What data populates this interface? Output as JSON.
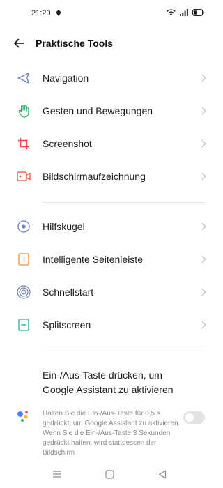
{
  "status_bar": {
    "time": "21:20",
    "icons": [
      "location-icon",
      "wifi-icon",
      "signal-icon",
      "battery-icon"
    ]
  },
  "header": {
    "back_icon": "arrow-left-icon",
    "title": "Praktische Tools"
  },
  "groups": [
    {
      "items": [
        {
          "label": "Navigation",
          "icon": "navigation-arrow-icon",
          "icon_color": "#6b7db3"
        },
        {
          "label": "Gesten und Bewegungen",
          "icon": "hand-gesture-icon",
          "icon_color": "#3aa76d"
        },
        {
          "label": "Screenshot",
          "icon": "crop-icon",
          "icon_color": "#e0533a"
        },
        {
          "label": "Bildschirmaufzeichnung",
          "icon": "screen-record-icon",
          "icon_color": "#e0533a"
        }
      ]
    },
    {
      "items": [
        {
          "label": "Hilfskugel",
          "icon": "assistive-ball-icon",
          "icon_color": "#6b7db3"
        },
        {
          "label": "Intelligente Seitenleiste",
          "icon": "sidebar-icon",
          "icon_color": "#e8923a"
        },
        {
          "label": "Schnellstart",
          "icon": "fingerprint-quick-launch-icon",
          "icon_color": "#6b7db3"
        },
        {
          "label": "Splitscreen",
          "icon": "split-screen-icon",
          "icon_color": "#2ea89a"
        }
      ]
    }
  ],
  "assistant": {
    "icon": "google-assistant-icon",
    "title": "Ein-/Aus-Taste drücken, um Google Assistant zu aktivieren",
    "description": "Halten Sie die Ein-/Aus-Taste für 0,5 s gedrückt, um Google Assistant zu aktivieren. Wenn Sie die Ein-/Aus-Taste 3 Sekunden gedrückt halten, wird stattdessen der Bildschirm",
    "toggle_on": false
  },
  "nav_bar": {
    "icons": [
      "menu-icon",
      "home-square-icon",
      "back-triangle-icon"
    ]
  },
  "colors": {
    "chevron": "#c4c4c4",
    "divider": "#e6e6e6",
    "toggle_off": "#e4e4e4"
  }
}
